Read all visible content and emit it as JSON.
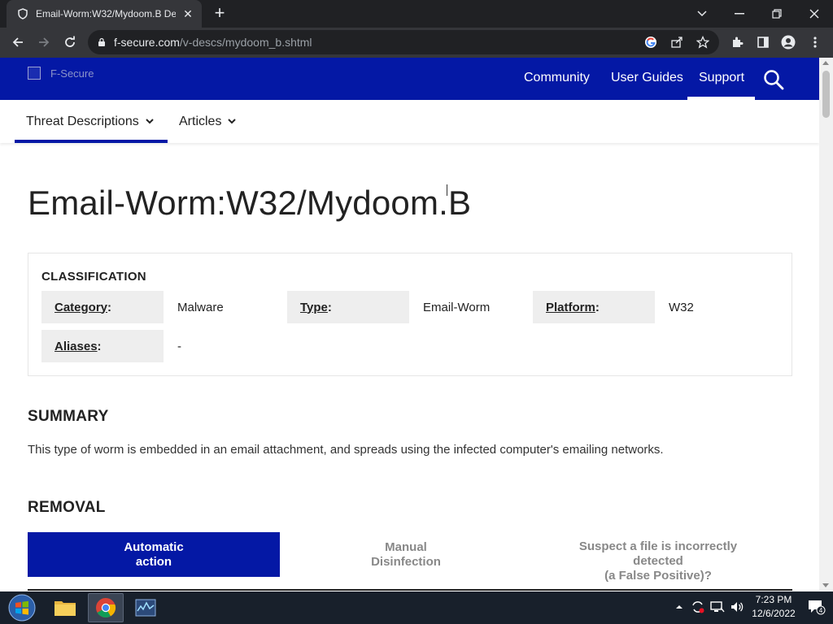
{
  "browser": {
    "tab_title": "Email-Worm:W32/Mydoom.B De",
    "url_host": "f-secure.com",
    "url_path": "/v-descs/mydoom_b.shtml"
  },
  "header": {
    "logo_alt": "F-Secure",
    "nav": [
      "Community",
      "User Guides",
      "Support"
    ]
  },
  "subnav": {
    "items": [
      "Threat Descriptions",
      "Articles"
    ]
  },
  "page": {
    "title": "Email-Worm:W32/Mydoom.B"
  },
  "classification": {
    "heading": "CLASSIFICATION",
    "category_key": "Category",
    "category_value": "Malware",
    "type_key": "Type",
    "type_value": "Email-Worm",
    "platform_key": "Platform",
    "platform_value": "W32",
    "aliases_key": "Aliases",
    "aliases_value": "-"
  },
  "summary": {
    "heading": "SUMMARY",
    "text": "This type of worm is embedded in an email attachment, and spreads using the infected computer's emailing networks."
  },
  "removal": {
    "heading": "REMOVAL",
    "tab1_line1": "Automatic",
    "tab1_line2": "action",
    "tab2_line1": "Manual",
    "tab2_line2": "Disinfection",
    "tab3_line1": "Suspect a file is incorrectly",
    "tab3_line2": "detected",
    "tab3_line3": "(a False Positive)?"
  },
  "taskbar": {
    "time": "7:23 PM",
    "date": "12/6/2022",
    "notification_count": "4"
  },
  "colors": {
    "brand_blue": "#0418a5",
    "chrome_dark": "#202124",
    "chrome_toolbar": "#35363a"
  }
}
